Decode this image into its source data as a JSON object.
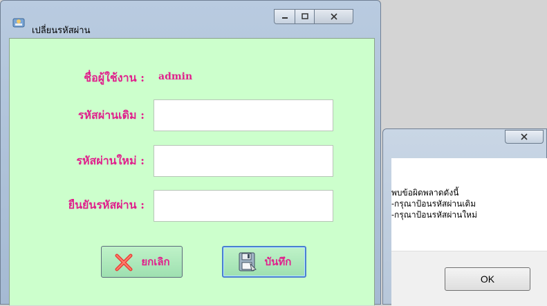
{
  "main_window": {
    "title": "เปลี่ยนรหัสผ่าน",
    "controls": {
      "minimize_icon": "minimize-icon",
      "maximize_icon": "maximize-icon",
      "close_icon": "close-icon"
    },
    "form": {
      "username_label": "ชื่อผู้ใช้งาน :",
      "username_value": "admin",
      "old_password_label": "รหัสผ่านเดิม :",
      "old_password_value": "",
      "new_password_label": "รหัสผ่านใหม่ :",
      "new_password_value": "",
      "confirm_password_label": "ยืนยันรหัสผ่าน :",
      "confirm_password_value": ""
    },
    "buttons": {
      "cancel_label": "ยกเลิก",
      "save_label": "บันทึก"
    },
    "colors": {
      "label": "#e0208c",
      "client_bg": "#ccffcc"
    }
  },
  "dialog": {
    "close_icon": "close-icon",
    "message_lines": [
      "พบข้อผิดพลาดดังนี้",
      "-กรุณาป้อนรหัสผ่านเดิม",
      "-กรุณาป้อนรหัสผ่านใหม่"
    ],
    "ok_label": "OK"
  }
}
